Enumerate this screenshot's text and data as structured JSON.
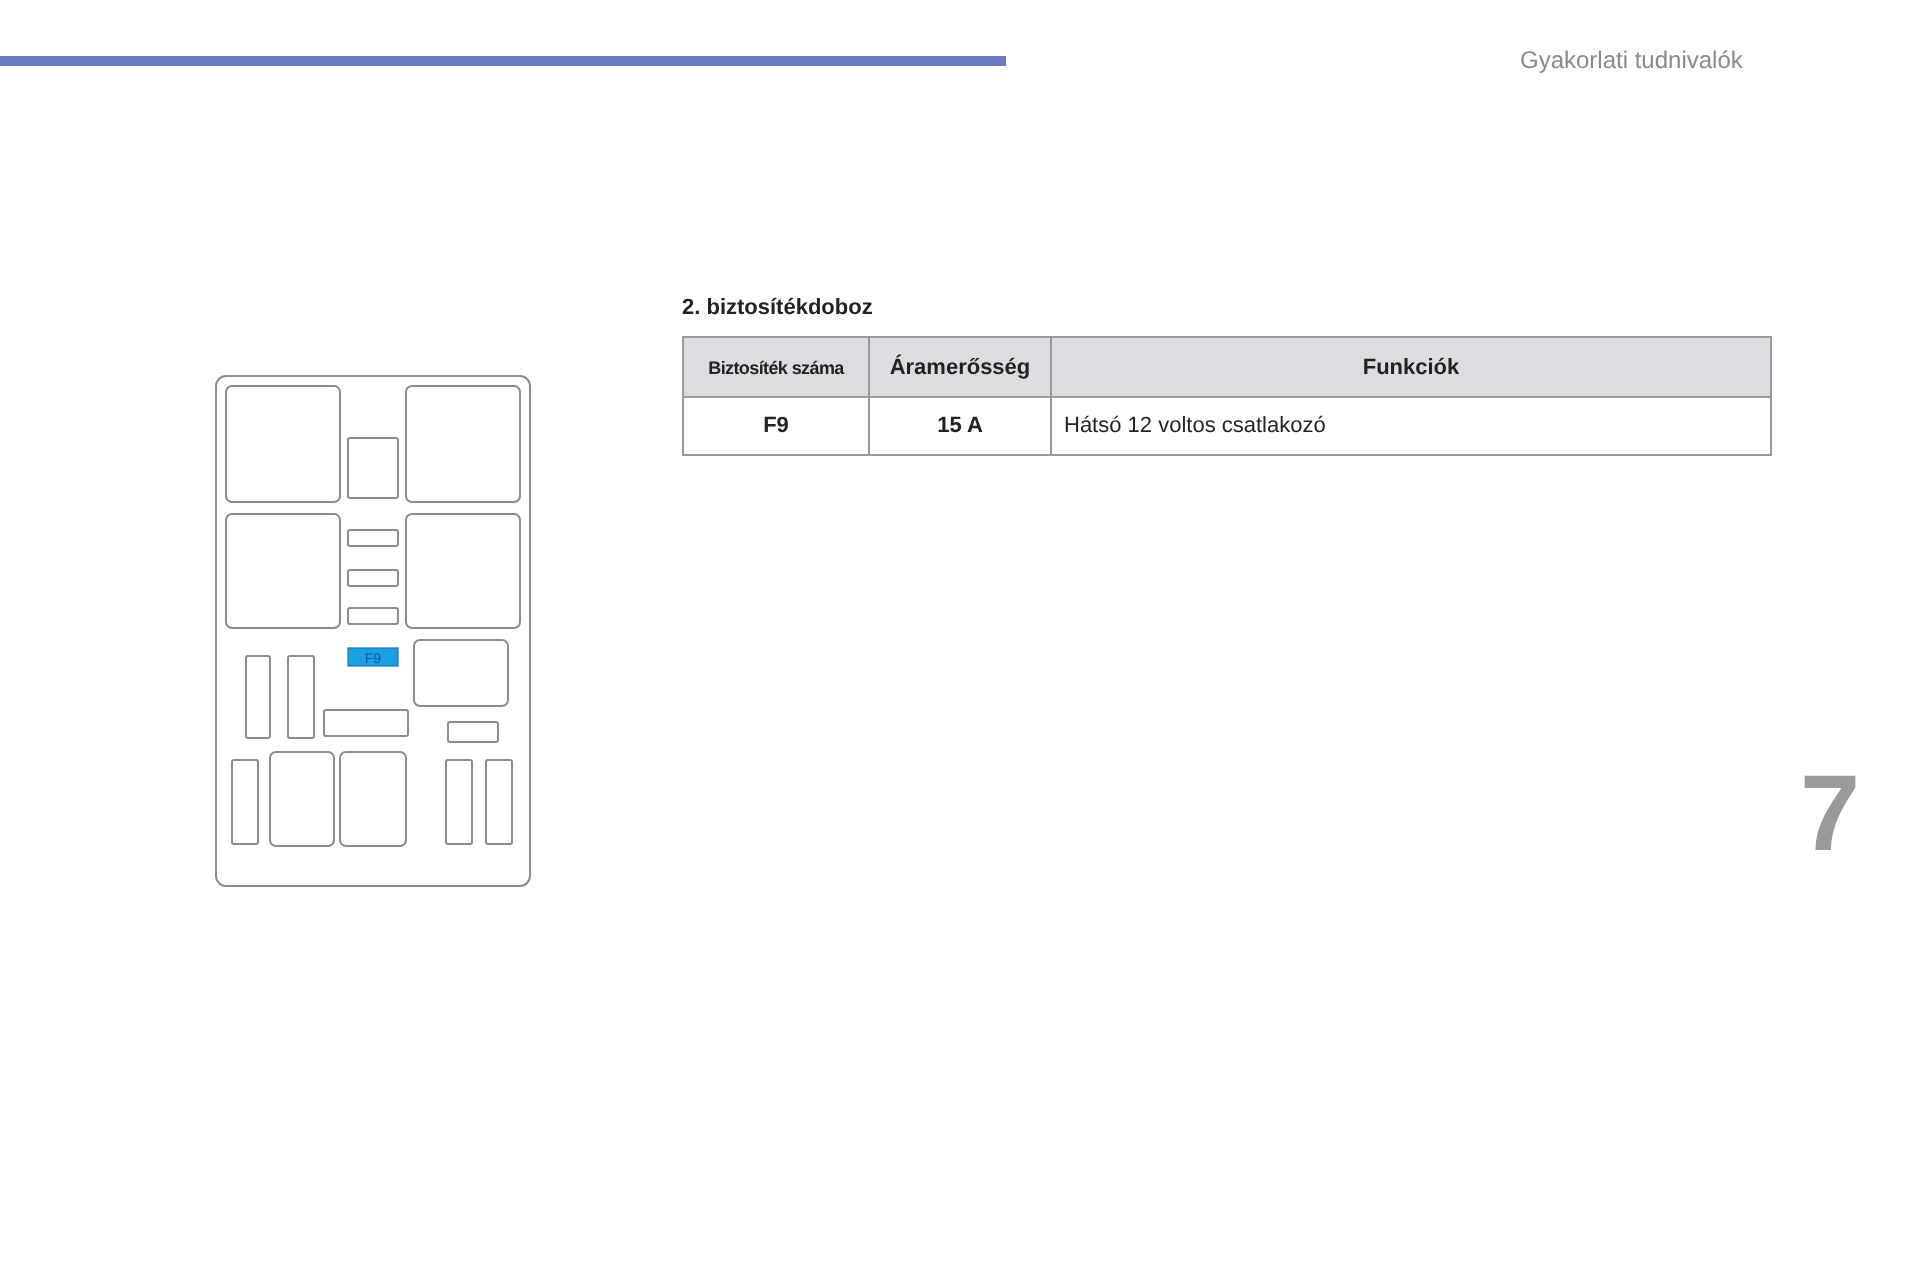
{
  "header": {
    "section_title": "Gyakorlati tudnivalók"
  },
  "diagram": {
    "highlighted_fuse": "F9"
  },
  "section": {
    "title": "2. biztosítékdoboz",
    "table": {
      "columns": [
        "Biztosíték száma",
        "Áramerősség",
        "Funkciók"
      ],
      "rows": [
        [
          "F9",
          "15 A",
          "Hátsó 12 voltos csatlakozó"
        ]
      ]
    }
  },
  "chapter_number": "7"
}
